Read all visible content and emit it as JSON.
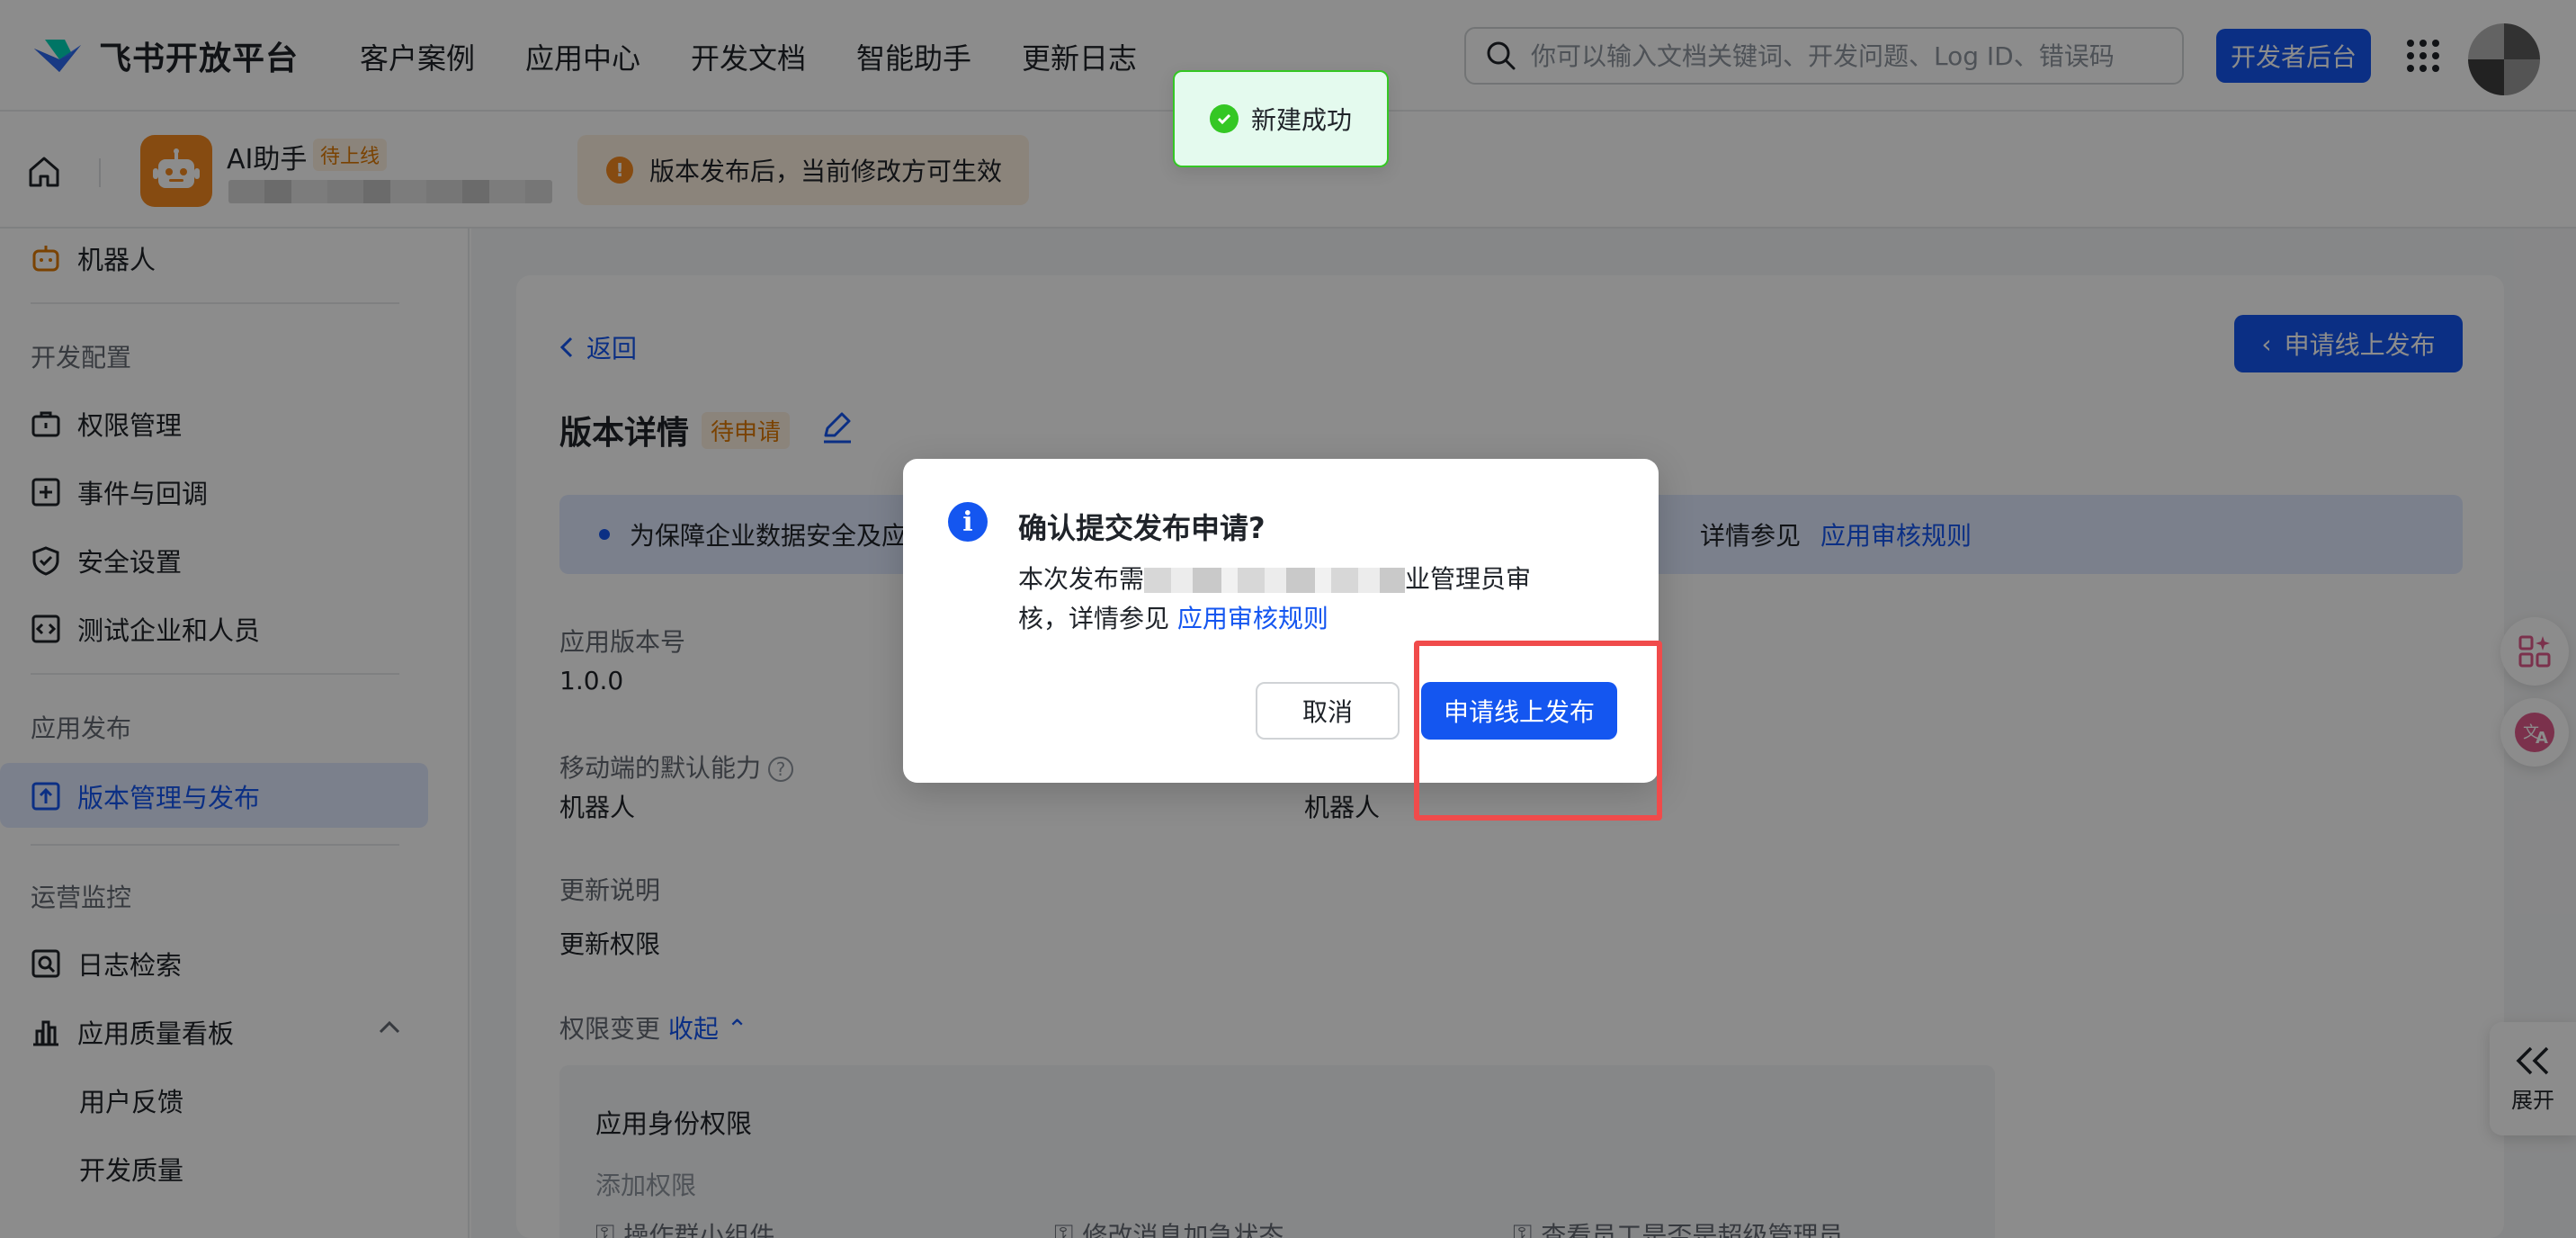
{
  "brand": {
    "name": "飞书开放平台"
  },
  "nav": {
    "links": [
      "客户案例",
      "应用中心",
      "开发文档",
      "智能助手",
      "更新日志"
    ],
    "search_placeholder": "你可以输入文档关键词、开发问题、Log ID、错误码",
    "dev_console": "开发者后台"
  },
  "app": {
    "name": "AI助手",
    "badge": "待上线"
  },
  "notice": {
    "icon": "!",
    "text": "版本发布后，当前修改方可生效"
  },
  "sidebar": {
    "top_item": "机器人",
    "groups": [
      {
        "title": "开发配置",
        "items": [
          "权限管理",
          "事件与回调",
          "安全设置",
          "测试企业和人员"
        ]
      },
      {
        "title": "应用发布",
        "items": [
          "版本管理与发布"
        ]
      },
      {
        "title": "运营监控",
        "items": [
          "日志检索",
          "应用质量看板",
          "用户反馈",
          "开发质量"
        ]
      }
    ]
  },
  "main": {
    "back": "返回",
    "apply_top": "申请线上发布",
    "title": "版本详情",
    "status": "待申请",
    "banner_text": "为保障企业数据安全及应",
    "banner_tail": "详情参见",
    "banner_link": "应用审核规则",
    "fields": {
      "version_label": "应用版本号",
      "version_value": "1.0.0",
      "mobile_label": "移动端的默认能力",
      "mobile_value": "机器人",
      "desktop_value": "机器人",
      "notes_label": "更新说明",
      "notes_value": "更新权限",
      "perm_change_label": "权限变更",
      "collapse": "收起"
    },
    "perm": {
      "title": "应用身份权限",
      "add": "添加权限",
      "items": [
        "操作群小组件",
        "修改消息加急状态",
        "查看员工是否是超级管理员"
      ]
    }
  },
  "toast": {
    "text": "新建成功"
  },
  "modal": {
    "icon": "i",
    "title": "确认提交发布申请?",
    "body_start": "本次发布需",
    "body_end": "业管理员审",
    "body_line2": "核，详情参见",
    "body_link": "应用审核规则",
    "cancel": "取消",
    "confirm": "申请线上发布"
  },
  "floating": {
    "expand": "展开"
  },
  "colors": {
    "primary": "#1456f0",
    "warning": "#f5891f",
    "success": "#34c724",
    "highlight": "#f04b4b"
  }
}
